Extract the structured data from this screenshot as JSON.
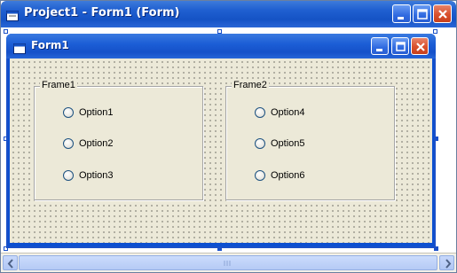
{
  "window": {
    "title": "Project1 - Form1 (Form)",
    "icon": "form-designer-icon",
    "controls": [
      "minimize-icon",
      "maximize-icon",
      "close-icon"
    ]
  },
  "form": {
    "title": "Form1",
    "icon": "form-icon",
    "controls": [
      "minimize-icon",
      "maximize-icon",
      "close-icon"
    ]
  },
  "frames": [
    {
      "caption": "Frame1",
      "options": [
        "Option1",
        "Option2",
        "Option3"
      ]
    },
    {
      "caption": "Frame2",
      "options": [
        "Option4",
        "Option5",
        "Option6"
      ]
    }
  ],
  "colors": {
    "titlebar": "#1553c5",
    "form_background": "#ece9d8",
    "selection_handle": "#1a50c8",
    "close_button": "#d9502c"
  }
}
